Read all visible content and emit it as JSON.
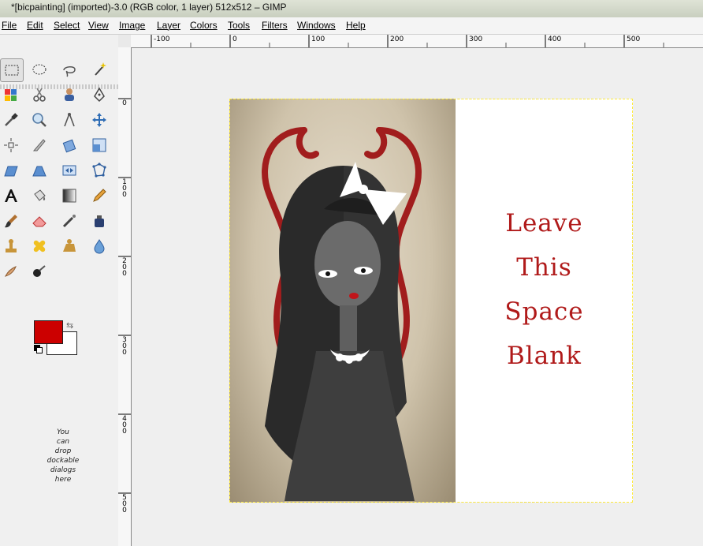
{
  "window": {
    "title": "*[bicpainting] (imported)-3.0 (RGB color, 1 layer) 512x512 – GIMP"
  },
  "menu": [
    "File",
    "Edit",
    "Select",
    "View",
    "Image",
    "Layer",
    "Colors",
    "Tools",
    "Filters",
    "Windows",
    "Help"
  ],
  "toolbox": {
    "tools": [
      "rect-select",
      "ellipse-select",
      "free-select",
      "fuzzy-select",
      "select-by-color",
      "scissors-select",
      "foreground-select",
      "paths",
      "color-picker",
      "zoom",
      "measure",
      "move",
      "align",
      "crop",
      "rotate",
      "scale",
      "shear",
      "perspective",
      "flip",
      "cage-transform",
      "text",
      "bucket-fill",
      "blend",
      "pencil",
      "paintbrush",
      "eraser",
      "airbrush",
      "ink",
      "clone",
      "heal",
      "perspective-clone",
      "blur",
      "smudge",
      "dodge-burn"
    ],
    "foreground_color": "#cc0000",
    "background_color": "#ffffff",
    "dock_hint": [
      "You",
      "can",
      "drop",
      "dockable",
      "dialogs",
      "here"
    ]
  },
  "rulers": {
    "horizontal": [
      "-100",
      "0",
      "100",
      "200",
      "300",
      "400",
      "500"
    ],
    "vertical": [
      "0",
      "100",
      "200",
      "300",
      "400",
      "500"
    ]
  },
  "canvas": {
    "blank_text": [
      "Leave",
      "This",
      "Space",
      "Blank"
    ],
    "accent_color": "#b01a1a"
  }
}
